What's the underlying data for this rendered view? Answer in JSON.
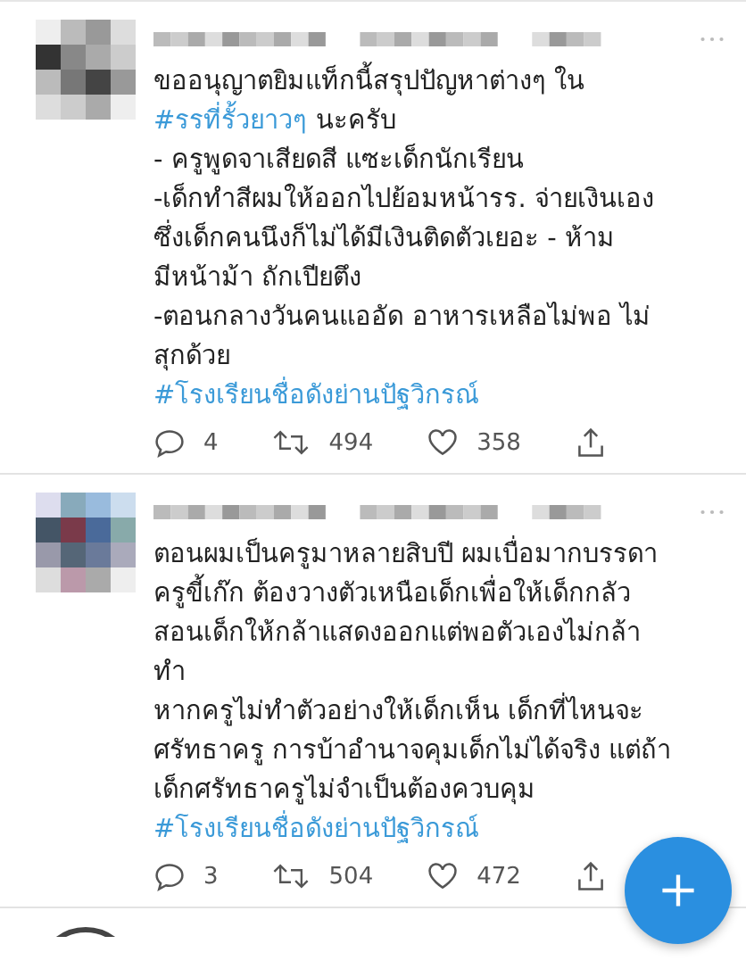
{
  "tweets": [
    {
      "kind": "full",
      "lines": [
        [
          {
            "kind": "plain",
            "text": "ขออนุญาตยิมแท็กนี้สรุปปัญหาต่างๆ ใน"
          }
        ],
        [
          {
            "kind": "hashtag",
            "text": "#รรที่รั้วยาวๆ"
          },
          {
            "kind": "plain",
            "text": " นะครับ"
          }
        ],
        [
          {
            "kind": "plain",
            "text": "- ครูพูดจาเสียดสี แซะเด็กนักเรียน"
          }
        ],
        [
          {
            "kind": "plain",
            "text": "-เด็กทำสีผมให้ออกไปย้อมหน้ารร. จ่ายเงินเอง"
          }
        ],
        [
          {
            "kind": "plain",
            "text": "ซึ่งเด็กคนนึงก็ไม่ได้มีเงินติดตัวเยอะ  - ห้าม"
          }
        ],
        [
          {
            "kind": "plain",
            "text": "มีหน้าม้า ถักเปียตึง"
          }
        ],
        [
          {
            "kind": "plain",
            "text": "-ตอนกลางวันคนแออัด อาหารเหลือไม่พอ ไม่"
          }
        ],
        [
          {
            "kind": "plain",
            "text": "สุกด้วย"
          }
        ],
        [
          {
            "kind": "hashtag",
            "text": "#โรงเรียนชื่อดังย่านปัฐวิกรณ์"
          }
        ]
      ],
      "replies": "4",
      "retweets": "494",
      "likes": "358"
    },
    {
      "kind": "full",
      "lines": [
        [
          {
            "kind": "plain",
            "text": "ตอนผมเป็นครูมาหลายสิบปี ผมเบื่อมากบรรดา"
          }
        ],
        [
          {
            "kind": "plain",
            "text": "ครูขี้เก๊ก ต้องวางตัวเหนือเด็กเพื่อให้เด็กกลัว"
          }
        ],
        [
          {
            "kind": "plain",
            "text": "สอนเด็กให้กล้าแสดงออกแต่พอตัวเองไม่กล้า"
          }
        ],
        [
          {
            "kind": "plain",
            "text": "ทำ"
          }
        ],
        [
          {
            "kind": "plain",
            "text": "หากครูไม่ทำตัวอย่างให้เด็กเห็น เด็กที่ไหนจะ"
          }
        ],
        [
          {
            "kind": "plain",
            "text": "ศรัทธาครู การบ้าอำนาจคุมเด็กไม่ได้จริง แต่ถ้า"
          }
        ],
        [
          {
            "kind": "plain",
            "text": "เด็กศรัทธาครูไม่จำเป็นต้องควบคุม"
          }
        ],
        [
          {
            "kind": "hashtag",
            "text": "#โรงเรียนชื่อดังย่านปัฐวิกรณ์"
          }
        ]
      ],
      "replies": "3",
      "retweets": "504",
      "likes": "472"
    },
    {
      "kind": "stub"
    }
  ]
}
